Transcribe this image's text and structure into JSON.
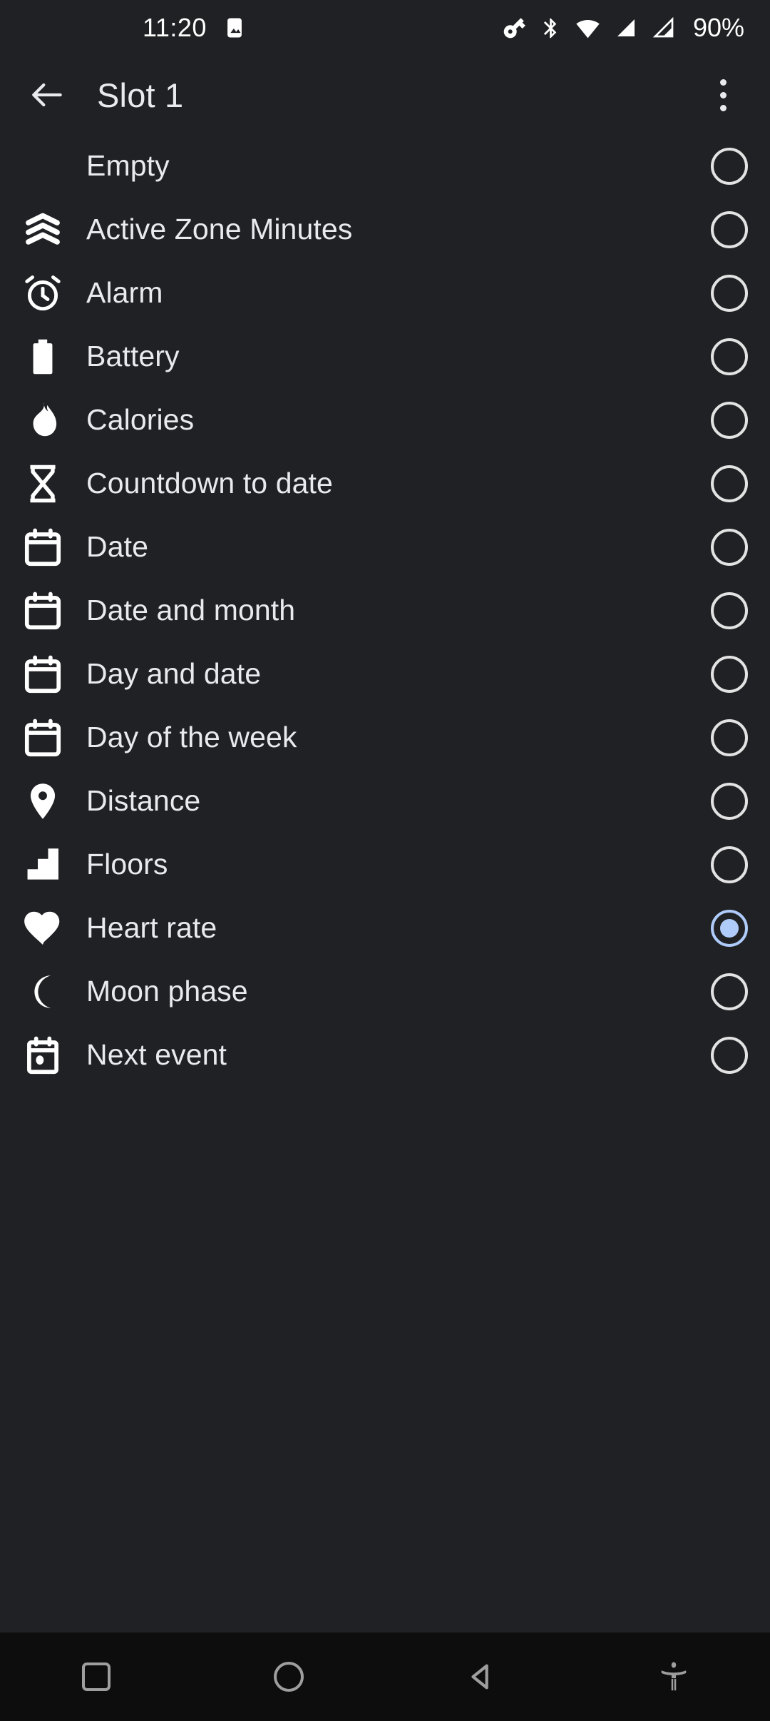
{
  "status_bar": {
    "time": "11:20",
    "battery": "90%",
    "left_icons": [
      "image-icon"
    ],
    "right_icons": [
      "vpn-key-icon",
      "bluetooth-icon",
      "wifi-icon",
      "cellular-signal-icon",
      "cellular-signal-alt-icon"
    ]
  },
  "app_bar": {
    "back_label": "back-arrow",
    "title": "Slot 1",
    "overflow_label": "more-options"
  },
  "list": {
    "items": [
      {
        "label": "Empty",
        "icon": "none",
        "selected": false
      },
      {
        "label": "Active Zone Minutes",
        "icon": "chevrons-up-icon",
        "selected": false
      },
      {
        "label": "Alarm",
        "icon": "alarm-clock-icon",
        "selected": false
      },
      {
        "label": "Battery",
        "icon": "battery-icon",
        "selected": false
      },
      {
        "label": "Calories",
        "icon": "flame-icon",
        "selected": false
      },
      {
        "label": "Countdown to date",
        "icon": "hourglass-icon",
        "selected": false
      },
      {
        "label": "Date",
        "icon": "calendar-icon",
        "selected": false
      },
      {
        "label": "Date and month",
        "icon": "calendar-icon",
        "selected": false
      },
      {
        "label": "Day and date",
        "icon": "calendar-icon",
        "selected": false
      },
      {
        "label": "Day of the week",
        "icon": "calendar-icon",
        "selected": false
      },
      {
        "label": "Distance",
        "icon": "location-pin-icon",
        "selected": false
      },
      {
        "label": "Floors",
        "icon": "stairs-icon",
        "selected": false
      },
      {
        "label": "Heart rate",
        "icon": "heart-icon",
        "selected": true
      },
      {
        "label": "Moon phase",
        "icon": "moon-icon",
        "selected": false
      },
      {
        "label": "Next event",
        "icon": "calendar-event-icon",
        "selected": false
      }
    ]
  },
  "nav_bar": {
    "buttons": [
      "recents-button",
      "home-button",
      "back-button",
      "accessibility-button"
    ]
  },
  "colors": {
    "background": "#202124",
    "nav_background": "#0d0d0d",
    "text": "#e8eaed",
    "icon": "#ffffff",
    "radio_unselected": "#e3e3e3",
    "radio_selected": "#aecbfa",
    "nav_icon": "#9e9e9e"
  }
}
